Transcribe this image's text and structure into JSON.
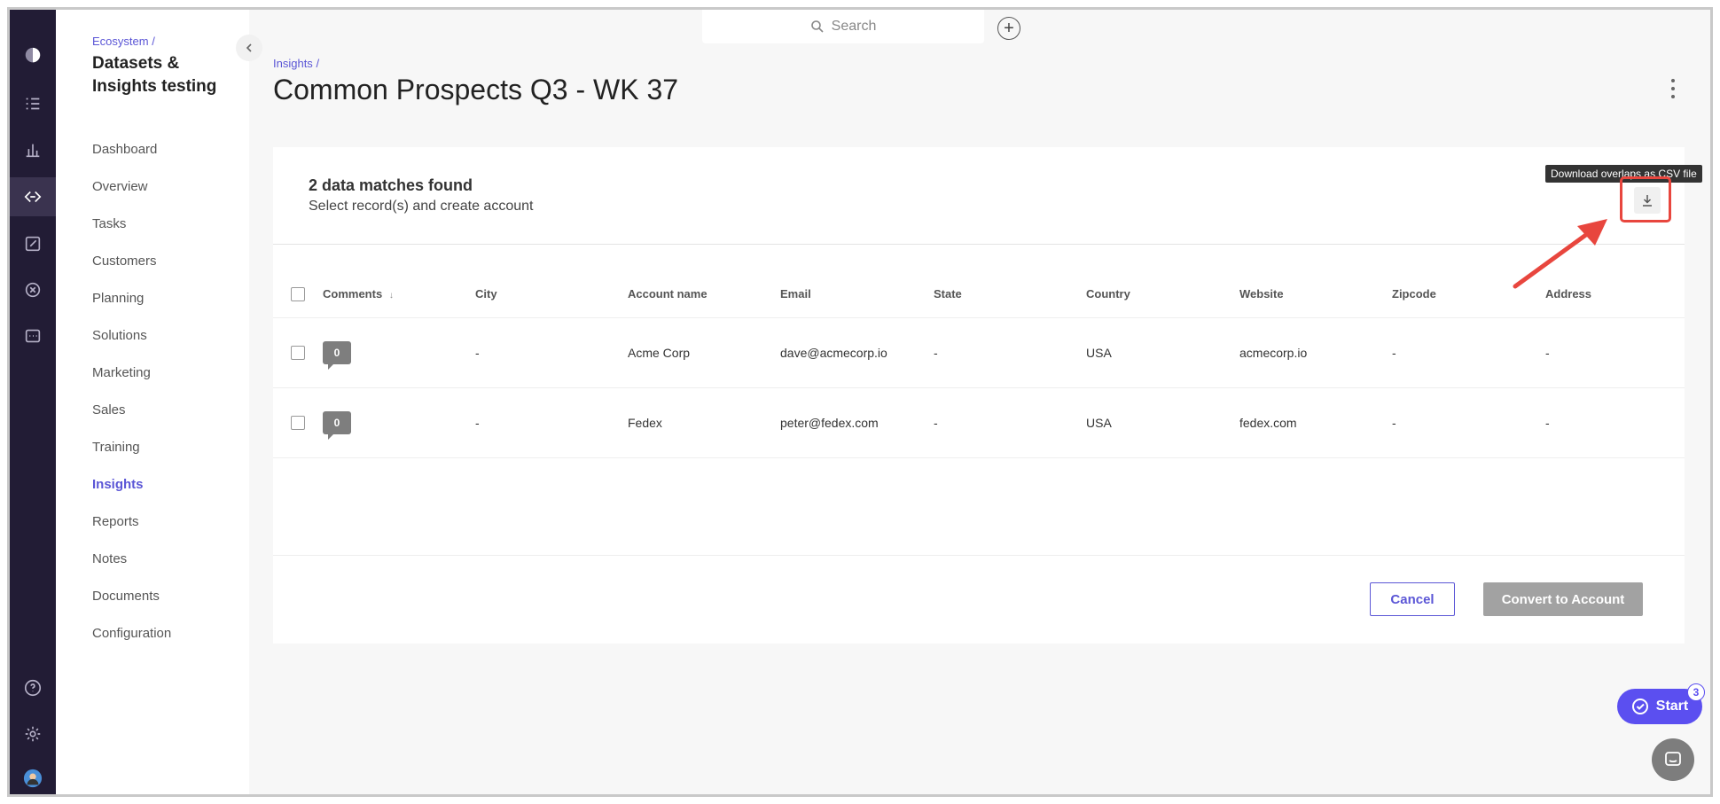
{
  "sidebar": {
    "breadcrumb": "Ecosystem",
    "breadcrumb_sep": "/",
    "workspace_title": "Datasets & Insights testing",
    "items": [
      {
        "label": "Dashboard"
      },
      {
        "label": "Overview"
      },
      {
        "label": "Tasks"
      },
      {
        "label": "Customers"
      },
      {
        "label": "Planning"
      },
      {
        "label": "Solutions"
      },
      {
        "label": "Marketing"
      },
      {
        "label": "Sales"
      },
      {
        "label": "Training"
      },
      {
        "label": "Insights",
        "active": true
      },
      {
        "label": "Reports"
      },
      {
        "label": "Notes"
      },
      {
        "label": "Documents"
      },
      {
        "label": "Configuration"
      }
    ]
  },
  "rail": {
    "icons": [
      "logo-icon",
      "checklist-icon",
      "bar-chart-icon",
      "ecosystem-icon",
      "edit-icon",
      "close-circle-icon",
      "terminal-icon",
      "help-icon",
      "settings-icon",
      "user-avatar"
    ],
    "active": "ecosystem-icon"
  },
  "topbar": {
    "search_placeholder": "Search",
    "plus": "+"
  },
  "page": {
    "breadcrumb": "Insights",
    "breadcrumb_sep": "/",
    "title": "Common Prospects Q3 - WK 37"
  },
  "card": {
    "matches": "2 data matches found",
    "subtext": "Select record(s) and create account",
    "tooltip": "Download overlaps as CSV file",
    "columns": [
      "Comments",
      "City",
      "Account name",
      "Email",
      "State",
      "Country",
      "Website",
      "Zipcode",
      "Address"
    ],
    "sort_indicator": "↓",
    "rows": [
      {
        "comments": "0",
        "city": "-",
        "account": "Acme Corp",
        "email": "dave@acmecorp.io",
        "state": "-",
        "country": "USA",
        "website": "acmecorp.io",
        "zipcode": "-",
        "address": "-"
      },
      {
        "comments": "0",
        "city": "-",
        "account": "Fedex",
        "email": "peter@fedex.com",
        "state": "-",
        "country": "USA",
        "website": "fedex.com",
        "zipcode": "-",
        "address": "-"
      }
    ],
    "cancel": "Cancel",
    "convert": "Convert to Account"
  },
  "widgets": {
    "start_label": "Start",
    "start_badge": "3"
  },
  "colors": {
    "accent": "#5b56d6",
    "rail_bg": "#221c35",
    "highlight": "#e8463e"
  }
}
